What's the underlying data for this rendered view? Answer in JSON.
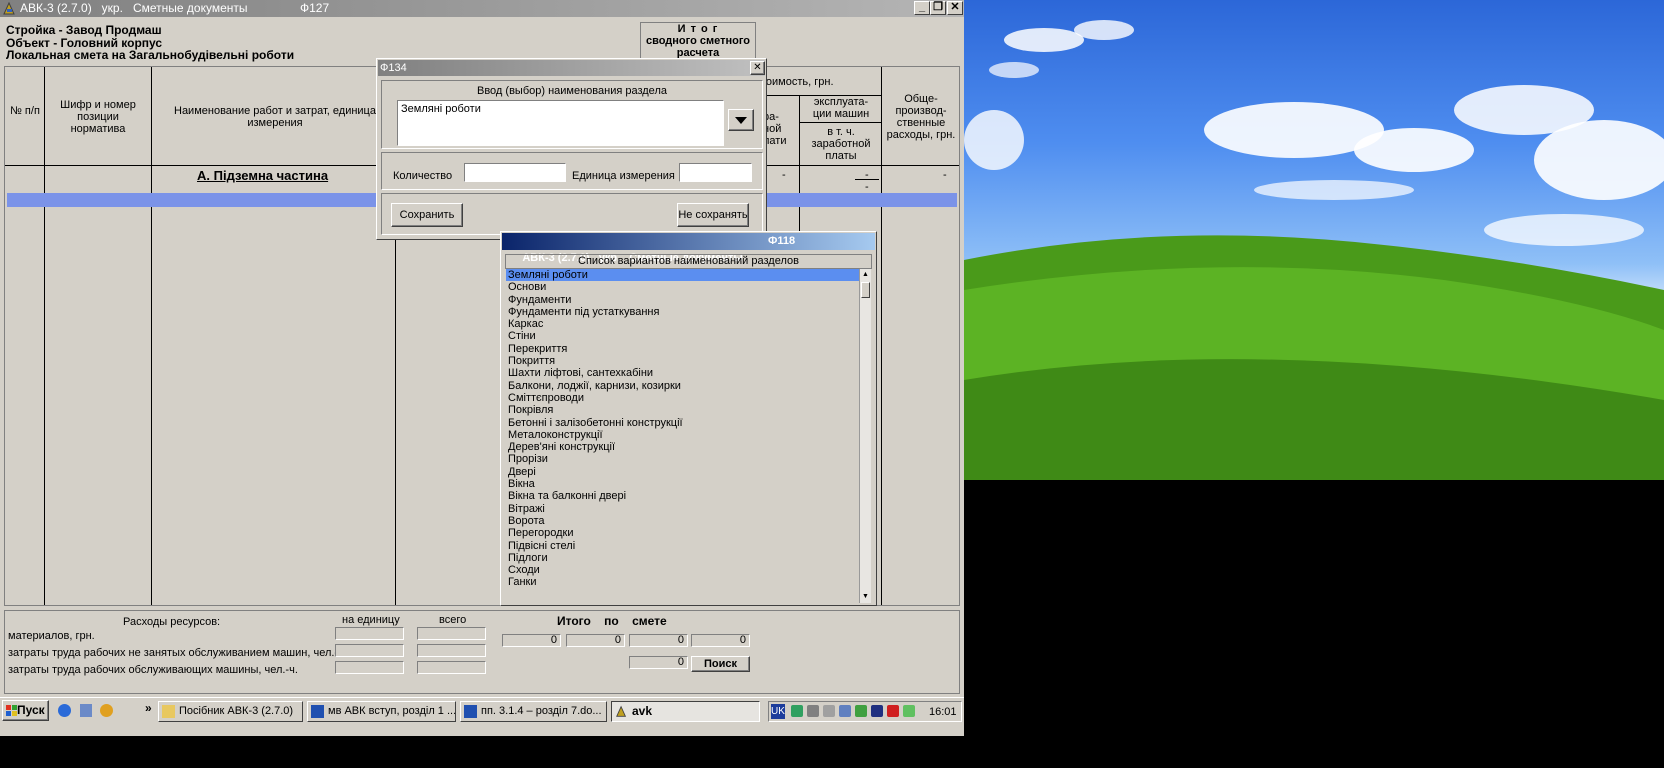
{
  "window": {
    "title": "АВК-3 (2.7.0)   укр.   Сметные документы",
    "form_code": "Ф127",
    "controls": [
      "_",
      "❐",
      "✕"
    ]
  },
  "header": {
    "line1": "Стройка - Завод Продмаш",
    "line2": "Объект - Головний корпус",
    "line3": "Локальная смета на Загальнобудівельні роботи",
    "itog_line1": "И т о г",
    "itog_line2": "сводного сметного",
    "itog_line3": "расчета"
  },
  "grid": {
    "col_num": "№ п/п",
    "col_code": "Шифр и номер позиции норматива",
    "col_name": "Наименование работ и затрат, единица измерения",
    "col_cost_partial": "тоимость, грн.",
    "col_pay_partial": "ра-\nной\nлати",
    "col_machines": "эксплуата-\nции машин",
    "col_machines_sub": "в т. ч.\nзаработной\nплаты",
    "col_overhead": "Обще-\nпроизвод-\nственные\nрасходы, грн.",
    "section_title": "А.   Підземна частина",
    "dash": "-"
  },
  "bottom": {
    "resources_label": "Расходы ресурсов:",
    "per_unit": "на единицу",
    "total": "всего",
    "materials": "материалов, грн.",
    "labor_not_machine": "затраты труда рабочих не занятых обслуживанием машин, чел.-ч.",
    "labor_machine": "затраты труда рабочих обслуживающих машины, чел.-ч.",
    "itogo_label": "Итого    по    смете",
    "totals": [
      "0",
      "0",
      "0",
      "0"
    ],
    "total_single": "0",
    "search_button": "Поиск"
  },
  "dialog134": {
    "title": "Ф134",
    "close": "✕",
    "section_label": "Ввод (выбор) наименования раздела",
    "section_value": "Земляні роботи",
    "qty_label": "Количество",
    "qty_value": "",
    "unit_label": "Единица измерения",
    "unit_value": "",
    "save_button": "Сохранить",
    "nosave_button": "Не сохранять"
  },
  "dialog118": {
    "title": "АВК-3 (2.7.0)   укр.   Сметные документы",
    "code": "Ф118",
    "list_header": "Список вариантов наименований разделов",
    "items": [
      "Земляні роботи",
      "Основи",
      "Фундаменти",
      "Фундаменти під устаткування",
      "Каркас",
      "Стіни",
      "Перекриття",
      "Покриття",
      "Шахти ліфтові, сантехкабіни",
      "Балкони, лоджії, карнизи, козирки",
      "Сміттєпроводи",
      "Покрівля",
      "Бетонні і залізобетонні конструкції",
      "Металоконструкції",
      "Дерев'яні конструкції",
      "Прорізи",
      "Двері",
      "Вікна",
      "Вікна та балконні двері",
      "Вітражі",
      "Ворота",
      "Перегородки",
      "Підвісні стелі",
      "Підлоги",
      "Сходи",
      "Ганки"
    ],
    "selected_index": 0
  },
  "taskbar": {
    "start": "Пуск",
    "tasks": [
      "Посібник АВК-3 (2.7.0)",
      "мв АВК вступ, розділ 1 ...",
      "пп. 3.1.4 – розділ 7.do...",
      "avk"
    ],
    "more": "»",
    "lang": "UK",
    "clock": "16:01"
  }
}
